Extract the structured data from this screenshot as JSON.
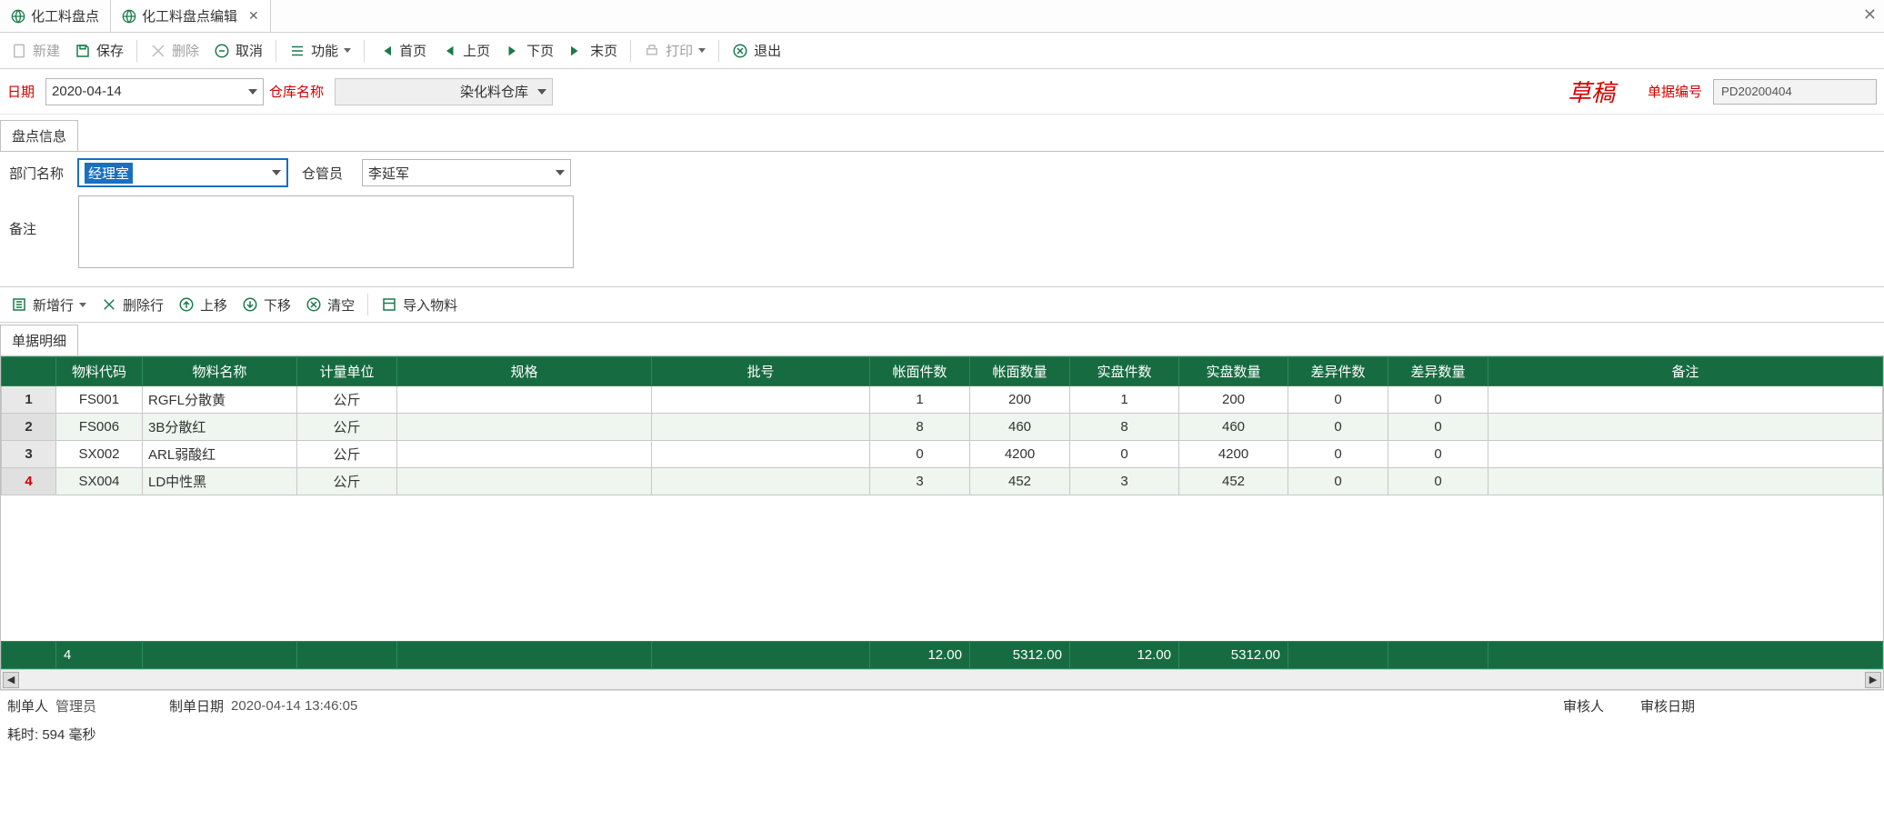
{
  "tabs": {
    "items": [
      {
        "label": "化工料盘点",
        "closable": false
      },
      {
        "label": "化工料盘点编辑",
        "closable": true
      }
    ]
  },
  "toolbar": {
    "new": "新建",
    "save": "保存",
    "delete": "删除",
    "cancel": "取消",
    "function": "功能",
    "first": "首页",
    "prev": "上页",
    "next": "下页",
    "last": "末页",
    "print": "打印",
    "exit": "退出"
  },
  "filter": {
    "date_label": "日期",
    "date_value": "2020-04-14",
    "warehouse_label": "仓库名称",
    "warehouse_value": "染化料仓库",
    "draft_stamp": "草稿",
    "docno_label": "单据编号",
    "docno_value": "PD20200404"
  },
  "info_section": {
    "tab_label": "盘点信息",
    "dept_label": "部门名称",
    "dept_value": "经理室",
    "keeper_label": "仓管员",
    "keeper_value": "李延军",
    "remark_label": "备注",
    "remark_value": ""
  },
  "row_toolbar": {
    "add_row": "新增行",
    "del_row": "删除行",
    "move_up": "上移",
    "move_down": "下移",
    "clear": "清空",
    "import": "导入物料"
  },
  "detail": {
    "tab_label": "单据明细",
    "columns": {
      "idx": "",
      "code": "物料代码",
      "name": "物料名称",
      "uom": "计量单位",
      "spec": "规格",
      "batch": "批号",
      "book_pcs": "帐面件数",
      "book_qty": "帐面数量",
      "actual_pcs": "实盘件数",
      "actual_qty": "实盘数量",
      "diff_pcs": "差异件数",
      "diff_qty": "差异数量",
      "remark": "备注"
    },
    "rows": [
      {
        "idx": "1",
        "code": "FS001",
        "name": "RGFL分散黄",
        "uom": "公斤",
        "spec": "",
        "batch": "",
        "book_pcs": "1",
        "book_qty": "200",
        "actual_pcs": "1",
        "actual_qty": "200",
        "diff_pcs": "0",
        "diff_qty": "0",
        "remark": ""
      },
      {
        "idx": "2",
        "code": "FS006",
        "name": "3B分散红",
        "uom": "公斤",
        "spec": "",
        "batch": "",
        "book_pcs": "8",
        "book_qty": "460",
        "actual_pcs": "8",
        "actual_qty": "460",
        "diff_pcs": "0",
        "diff_qty": "0",
        "remark": ""
      },
      {
        "idx": "3",
        "code": "SX002",
        "name": "ARL弱酸红",
        "uom": "公斤",
        "spec": "",
        "batch": "",
        "book_pcs": "0",
        "book_qty": "4200",
        "actual_pcs": "0",
        "actual_qty": "4200",
        "diff_pcs": "0",
        "diff_qty": "0",
        "remark": ""
      },
      {
        "idx": "4",
        "code": "SX004",
        "name": "LD中性黑",
        "uom": "公斤",
        "spec": "",
        "batch": "",
        "book_pcs": "3",
        "book_qty": "452",
        "actual_pcs": "3",
        "actual_qty": "452",
        "diff_pcs": "0",
        "diff_qty": "0",
        "remark": ""
      }
    ],
    "totals": {
      "count": "4",
      "book_pcs": "12.00",
      "book_qty": "5312.00",
      "actual_pcs": "12.00",
      "actual_qty": "5312.00"
    }
  },
  "footer": {
    "maker_label": "制单人",
    "maker_value": "管理员",
    "make_date_label": "制单日期",
    "make_date_value": "2020-04-14 13:46:05",
    "auditor_label": "审核人",
    "audit_date_label": "审核日期"
  },
  "status": "耗时: 594 毫秒"
}
